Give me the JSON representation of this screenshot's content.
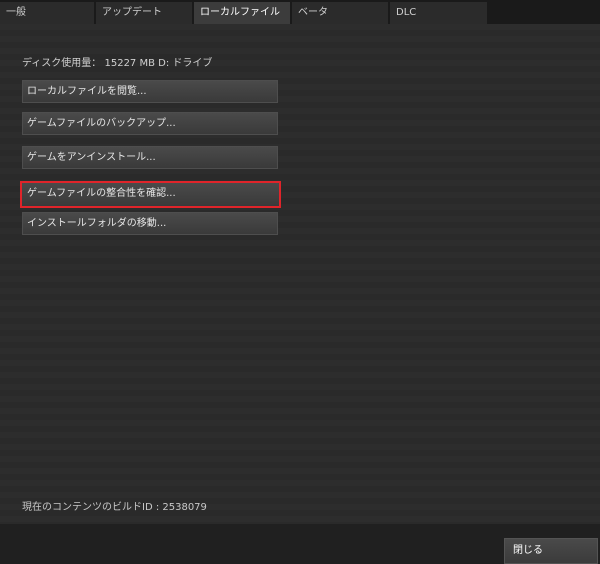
{
  "tabs": [
    {
      "label": "一般"
    },
    {
      "label": "アップデート"
    },
    {
      "label": "ローカルファイル"
    },
    {
      "label": "ベータ"
    },
    {
      "label": "DLC"
    }
  ],
  "local_files": {
    "disk_usage": "ディスク使用量： 15227 MB D: ドライブ",
    "buttons": [
      {
        "label": "ローカルファイルを閲覧..."
      },
      {
        "label": "ゲームファイルのバックアップ..."
      },
      {
        "label": "ゲームをアンインストール..."
      },
      {
        "label": "ゲームファイルの整合性を確認..."
      },
      {
        "label": "インストールフォルダの移動..."
      }
    ],
    "build_id": "現在のコンテンツのビルドID : 2538079"
  },
  "footer": {
    "close_label": "閉じる"
  },
  "colors": {
    "highlight_border": "#e0242a",
    "active_tab": "#3c3c3c"
  }
}
